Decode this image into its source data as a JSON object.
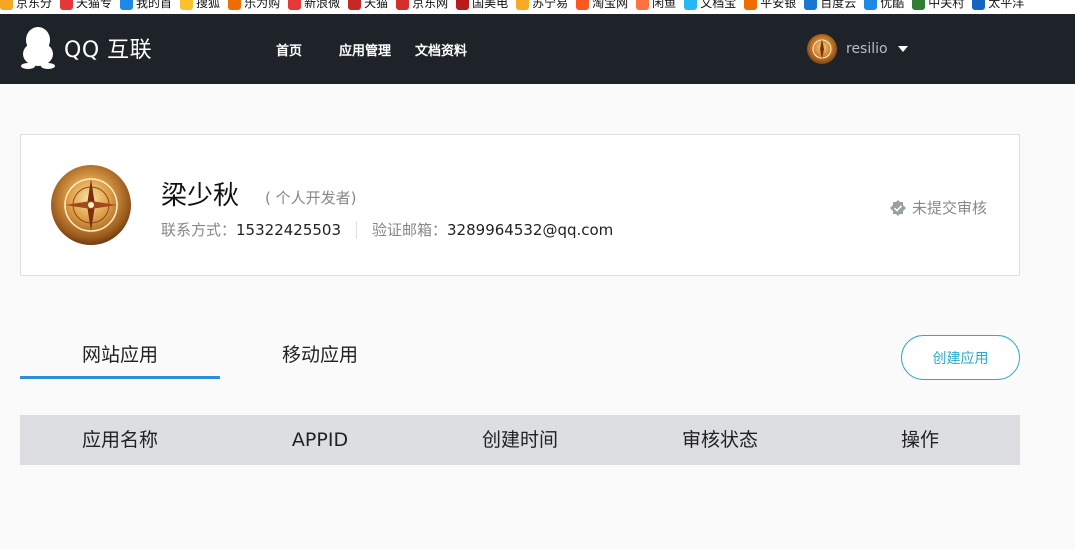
{
  "bookmarks": [
    {
      "label": "京东分",
      "color": "#f5a623"
    },
    {
      "label": "天猫专",
      "color": "#e3393c"
    },
    {
      "label": "我的首",
      "color": "#1e88e5"
    },
    {
      "label": "搜狐",
      "color": "#fbc02d"
    },
    {
      "label": "乐为购",
      "color": "#ef6c00"
    },
    {
      "label": "新浪微",
      "color": "#e53935"
    },
    {
      "label": "天猫",
      "color": "#c62828"
    },
    {
      "label": "京东网",
      "color": "#d32f2f"
    },
    {
      "label": "国美电",
      "color": "#b71c1c"
    },
    {
      "label": "苏宁易",
      "color": "#f9a825"
    },
    {
      "label": "淘宝网",
      "color": "#ff5722"
    },
    {
      "label": "闲鱼",
      "color": "#ff7043"
    },
    {
      "label": "文档宝",
      "color": "#29b6f6"
    },
    {
      "label": "平安银",
      "color": "#ef6c00"
    },
    {
      "label": "百度云",
      "color": "#1976d2"
    },
    {
      "label": "优酷",
      "color": "#1e88e5"
    },
    {
      "label": "中关村",
      "color": "#2e7d32"
    },
    {
      "label": "太平洋",
      "color": "#1565c0"
    }
  ],
  "header": {
    "logo_text": "QQ 互联",
    "nav": [
      "首页",
      "应用管理",
      "文档资料"
    ],
    "username": "resilio"
  },
  "profile": {
    "name": "梁少秋",
    "role": "( 个人开发者)",
    "contact_label": "联系方式：",
    "contact_value": "15322425503",
    "email_label": "验证邮箱：",
    "email_value": "3289964532@qq.com",
    "status": "未提交审核"
  },
  "tabs": [
    "网站应用",
    "移动应用"
  ],
  "create_button": "创建应用",
  "table": {
    "columns": [
      "应用名称",
      "APPID",
      "创建时间",
      "审核状态",
      "操作"
    ]
  },
  "colors": {
    "topbar": "#1e2329",
    "accent": "#2d8fd5",
    "button": "#2aabc8"
  }
}
